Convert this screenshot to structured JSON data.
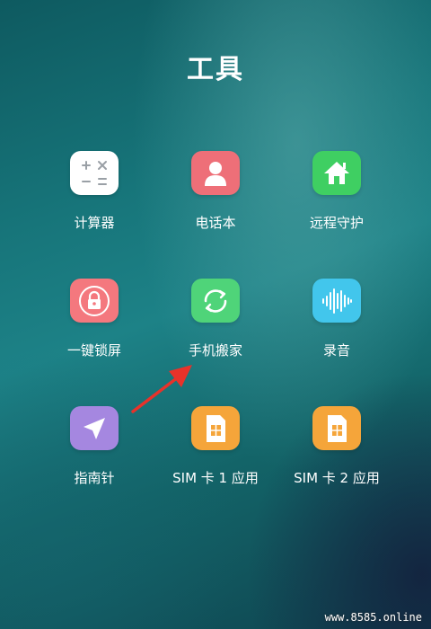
{
  "page": {
    "title": "工具"
  },
  "apps": [
    {
      "label": "计算器",
      "icon": "calculator-icon",
      "color": "#ffffff"
    },
    {
      "label": "电话本",
      "icon": "contacts-icon",
      "color": "#ee6f78"
    },
    {
      "label": "远程守护",
      "icon": "home-icon",
      "color": "#3fcf62"
    },
    {
      "label": "一键锁屏",
      "icon": "lock-icon",
      "color": "#f4787e"
    },
    {
      "label": "手机搬家",
      "icon": "sync-icon",
      "color": "#4fd479"
    },
    {
      "label": "录音",
      "icon": "voice-recorder-icon",
      "color": "#42c6ec"
    },
    {
      "label": "指南针",
      "icon": "compass-icon",
      "color": "#a587e0"
    },
    {
      "label": "SIM 卡 1 应用",
      "icon": "sim-card-icon",
      "color": "#f5a53a"
    },
    {
      "label": "SIM 卡 2 应用",
      "icon": "sim-card-icon",
      "color": "#f5a53a"
    }
  ],
  "watermark": "www.8585.online",
  "annotation": {
    "arrow_color": "#e8322a"
  }
}
